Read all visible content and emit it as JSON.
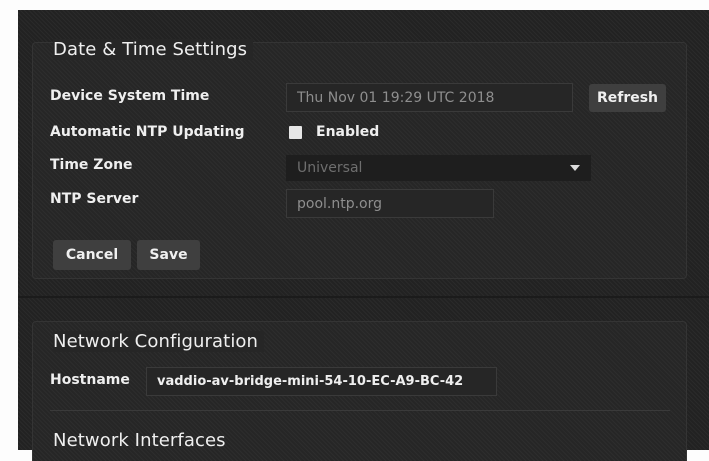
{
  "datetime": {
    "title": "Date & Time Settings",
    "device_time_label": "Device System Time",
    "device_time_value": "Thu Nov 01 19:29 UTC 2018",
    "refresh_label": "Refresh",
    "ntp_label": "Automatic NTP Updating",
    "ntp_checkbox_label": "Enabled",
    "ntp_enabled": false,
    "timezone_label": "Time Zone",
    "timezone_value": "Universal",
    "ntp_server_label": "NTP Server",
    "ntp_server_value": "pool.ntp.org",
    "cancel_label": "Cancel",
    "save_label": "Save"
  },
  "network": {
    "title": "Network Configuration",
    "hostname_label": "Hostname",
    "hostname_value": "vaddio-av-bridge-mini-54-10-EC-A9-BC-42",
    "interfaces_title": "Network Interfaces"
  },
  "colors": {
    "panel_bg": "#262626",
    "page_bg": "#222222",
    "button_bg": "#3f3f3f",
    "text": "#efefef",
    "muted_text": "#8e8e8e"
  }
}
